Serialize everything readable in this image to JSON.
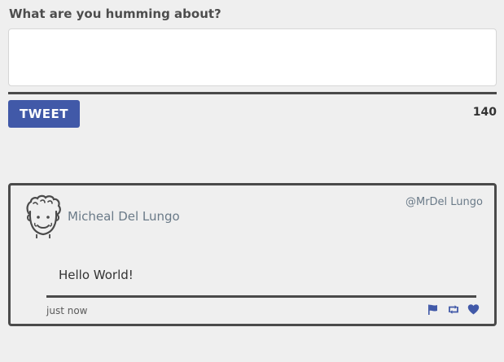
{
  "compose": {
    "label": "What are you humming about?",
    "textarea_value": "",
    "tweet_button_label": "TWEET",
    "char_counter": "140"
  },
  "tweet": {
    "author_name": "Micheal Del Lungo",
    "author_handle": "@MrDel Lungo",
    "body": "Hello World!",
    "timestamp": "just now",
    "avatar_icon": "cartoon-face-avatar",
    "actions": [
      {
        "icon": "flag-icon"
      },
      {
        "icon": "retweet-icon"
      },
      {
        "icon": "heart-icon"
      }
    ]
  },
  "colors": {
    "background": "#efefef",
    "accent": "#4159a8",
    "text_dark": "#4a4a4a",
    "text_muted": "#6a7a88"
  }
}
